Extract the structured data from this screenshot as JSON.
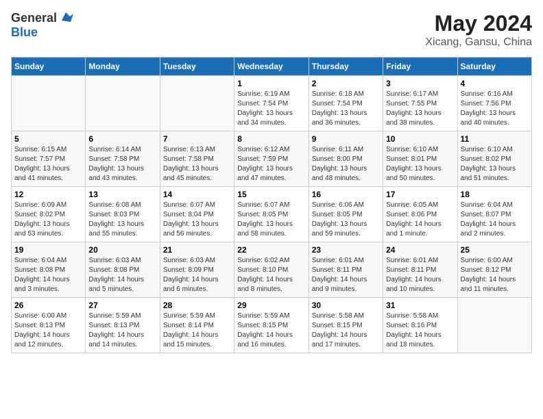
{
  "logo": {
    "general": "General",
    "blue": "Blue"
  },
  "title": "May 2024",
  "subtitle": "Xicang, Gansu, China",
  "days_of_week": [
    "Sunday",
    "Monday",
    "Tuesday",
    "Wednesday",
    "Thursday",
    "Friday",
    "Saturday"
  ],
  "weeks": [
    [
      {
        "day": "",
        "info": ""
      },
      {
        "day": "",
        "info": ""
      },
      {
        "day": "",
        "info": ""
      },
      {
        "day": "1",
        "info": "Sunrise: 6:19 AM\nSunset: 7:54 PM\nDaylight: 13 hours\nand 34 minutes."
      },
      {
        "day": "2",
        "info": "Sunrise: 6:18 AM\nSunset: 7:54 PM\nDaylight: 13 hours\nand 36 minutes."
      },
      {
        "day": "3",
        "info": "Sunrise: 6:17 AM\nSunset: 7:55 PM\nDaylight: 13 hours\nand 38 minutes."
      },
      {
        "day": "4",
        "info": "Sunrise: 6:16 AM\nSunset: 7:56 PM\nDaylight: 13 hours\nand 40 minutes."
      }
    ],
    [
      {
        "day": "5",
        "info": "Sunrise: 6:15 AM\nSunset: 7:57 PM\nDaylight: 13 hours\nand 41 minutes."
      },
      {
        "day": "6",
        "info": "Sunrise: 6:14 AM\nSunset: 7:58 PM\nDaylight: 13 hours\nand 43 minutes."
      },
      {
        "day": "7",
        "info": "Sunrise: 6:13 AM\nSunset: 7:58 PM\nDaylight: 13 hours\nand 45 minutes."
      },
      {
        "day": "8",
        "info": "Sunrise: 6:12 AM\nSunset: 7:59 PM\nDaylight: 13 hours\nand 47 minutes."
      },
      {
        "day": "9",
        "info": "Sunrise: 6:11 AM\nSunset: 8:00 PM\nDaylight: 13 hours\nand 48 minutes."
      },
      {
        "day": "10",
        "info": "Sunrise: 6:10 AM\nSunset: 8:01 PM\nDaylight: 13 hours\nand 50 minutes."
      },
      {
        "day": "11",
        "info": "Sunrise: 6:10 AM\nSunset: 8:02 PM\nDaylight: 13 hours\nand 51 minutes."
      }
    ],
    [
      {
        "day": "12",
        "info": "Sunrise: 6:09 AM\nSunset: 8:02 PM\nDaylight: 13 hours\nand 53 minutes."
      },
      {
        "day": "13",
        "info": "Sunrise: 6:08 AM\nSunset: 8:03 PM\nDaylight: 13 hours\nand 55 minutes."
      },
      {
        "day": "14",
        "info": "Sunrise: 6:07 AM\nSunset: 8:04 PM\nDaylight: 13 hours\nand 56 minutes."
      },
      {
        "day": "15",
        "info": "Sunrise: 6:07 AM\nSunset: 8:05 PM\nDaylight: 13 hours\nand 58 minutes."
      },
      {
        "day": "16",
        "info": "Sunrise: 6:06 AM\nSunset: 8:05 PM\nDaylight: 13 hours\nand 59 minutes."
      },
      {
        "day": "17",
        "info": "Sunrise: 6:05 AM\nSunset: 8:06 PM\nDaylight: 14 hours\nand 1 minute."
      },
      {
        "day": "18",
        "info": "Sunrise: 6:04 AM\nSunset: 8:07 PM\nDaylight: 14 hours\nand 2 minutes."
      }
    ],
    [
      {
        "day": "19",
        "info": "Sunrise: 6:04 AM\nSunset: 8:08 PM\nDaylight: 14 hours\nand 3 minutes."
      },
      {
        "day": "20",
        "info": "Sunrise: 6:03 AM\nSunset: 8:08 PM\nDaylight: 14 hours\nand 5 minutes."
      },
      {
        "day": "21",
        "info": "Sunrise: 6:03 AM\nSunset: 8:09 PM\nDaylight: 14 hours\nand 6 minutes."
      },
      {
        "day": "22",
        "info": "Sunrise: 6:02 AM\nSunset: 8:10 PM\nDaylight: 14 hours\nand 8 minutes."
      },
      {
        "day": "23",
        "info": "Sunrise: 6:01 AM\nSunset: 8:11 PM\nDaylight: 14 hours\nand 9 minutes."
      },
      {
        "day": "24",
        "info": "Sunrise: 6:01 AM\nSunset: 8:11 PM\nDaylight: 14 hours\nand 10 minutes."
      },
      {
        "day": "25",
        "info": "Sunrise: 6:00 AM\nSunset: 8:12 PM\nDaylight: 14 hours\nand 11 minutes."
      }
    ],
    [
      {
        "day": "26",
        "info": "Sunrise: 6:00 AM\nSunset: 8:13 PM\nDaylight: 14 hours\nand 12 minutes."
      },
      {
        "day": "27",
        "info": "Sunrise: 5:59 AM\nSunset: 8:13 PM\nDaylight: 14 hours\nand 14 minutes."
      },
      {
        "day": "28",
        "info": "Sunrise: 5:59 AM\nSunset: 8:14 PM\nDaylight: 14 hours\nand 15 minutes."
      },
      {
        "day": "29",
        "info": "Sunrise: 5:59 AM\nSunset: 8:15 PM\nDaylight: 14 hours\nand 16 minutes."
      },
      {
        "day": "30",
        "info": "Sunrise: 5:58 AM\nSunset: 8:15 PM\nDaylight: 14 hours\nand 17 minutes."
      },
      {
        "day": "31",
        "info": "Sunrise: 5:58 AM\nSunset: 8:16 PM\nDaylight: 14 hours\nand 18 minutes."
      },
      {
        "day": "",
        "info": ""
      }
    ]
  ]
}
